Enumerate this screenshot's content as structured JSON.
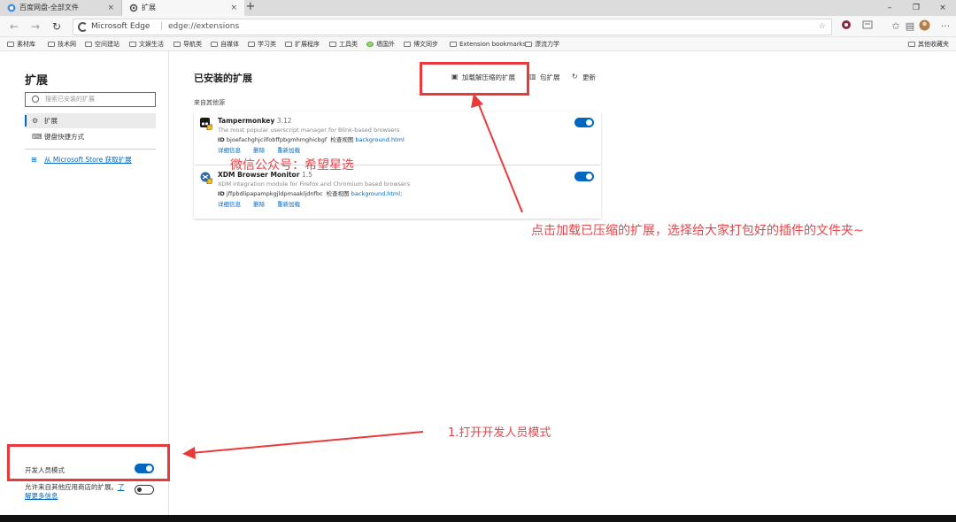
{
  "browser": {
    "tabs": [
      {
        "label": "百度网盘-全部文件",
        "close": "×"
      },
      {
        "label": "扩展",
        "close": "×"
      }
    ],
    "new_tab": "+",
    "window_controls": {
      "minimize": "–",
      "maximize": "❐",
      "close": "×"
    },
    "address": {
      "brand": "Microsoft Edge",
      "separator": "|",
      "url": "edge://extensions",
      "star": "☆"
    },
    "toolbar_icons": [
      "extension-icon",
      "reading-list-icon",
      "favorites-icon",
      "collections-icon",
      "profile-avatar",
      "more-icon"
    ],
    "more": "···"
  },
  "bookmarks": {
    "items": [
      "素材库",
      "技术网",
      "空间建站",
      "文娱生活",
      "导航类",
      "自媒体",
      "学习类",
      "扩展程序",
      "工具类",
      "墙国外",
      "博文同步",
      "Extension bookmarks",
      "漂流力学"
    ],
    "other": "其他收藏夹"
  },
  "sidebar": {
    "title": "扩展",
    "search_placeholder": "搜索已安装的扩展",
    "items": [
      {
        "label": "扩展",
        "icon": "⚙"
      },
      {
        "label": "键盘快捷方式",
        "icon": "⌨"
      }
    ],
    "store_link": "从 Microsoft Store 获取扩展",
    "dev_mode_label": "开发人员模式",
    "dev_mode_on": true,
    "allow_other_stores": "允许来自其他应用商店的扩展。",
    "learn_more_1": "了",
    "learn_more_2": "解更多信息",
    "allow_other_on": false
  },
  "main": {
    "title": "已安装的扩展",
    "actions": {
      "load_unpacked": "加载解压缩的扩展",
      "pack": "包扩展",
      "update": "更新"
    },
    "source_heading": "来自其他源",
    "extensions": [
      {
        "name": "Tampermonkey",
        "version": "3.12",
        "description": "The most popular userscript manager for Blink-based browsers",
        "id_label": "ID",
        "id": "bjoefachghjcilfobffpbgmhmghicbgf",
        "inspect_label": "检查视图",
        "inspect_link": "background.html",
        "links": [
          "详细信息",
          "删除",
          "重新加载"
        ],
        "enabled": true,
        "logo_color": "#1a1a1a"
      },
      {
        "name": "XDM Browser Monitor",
        "version": "1.5",
        "description": "XDM integration module for Firefox and Chromium based browsers",
        "id_label": "ID",
        "id": "jffpbdlipapampkgjldpmaakljdnfbc",
        "inspect_label": "检查视图",
        "inspect_link": "background.html;",
        "links": [
          "详细信息",
          "删除",
          "重新加载"
        ],
        "enabled": true,
        "logo_color": "#2b6cb0"
      }
    ]
  },
  "annotations": {
    "wechat": "微信公众号：希望星选",
    "note_load": "点击加载已压缩的扩展，选择给大家打包好的插件的文件夹~",
    "note_dev": "1.打开开发人员模式",
    "color": "#e83a3a"
  }
}
